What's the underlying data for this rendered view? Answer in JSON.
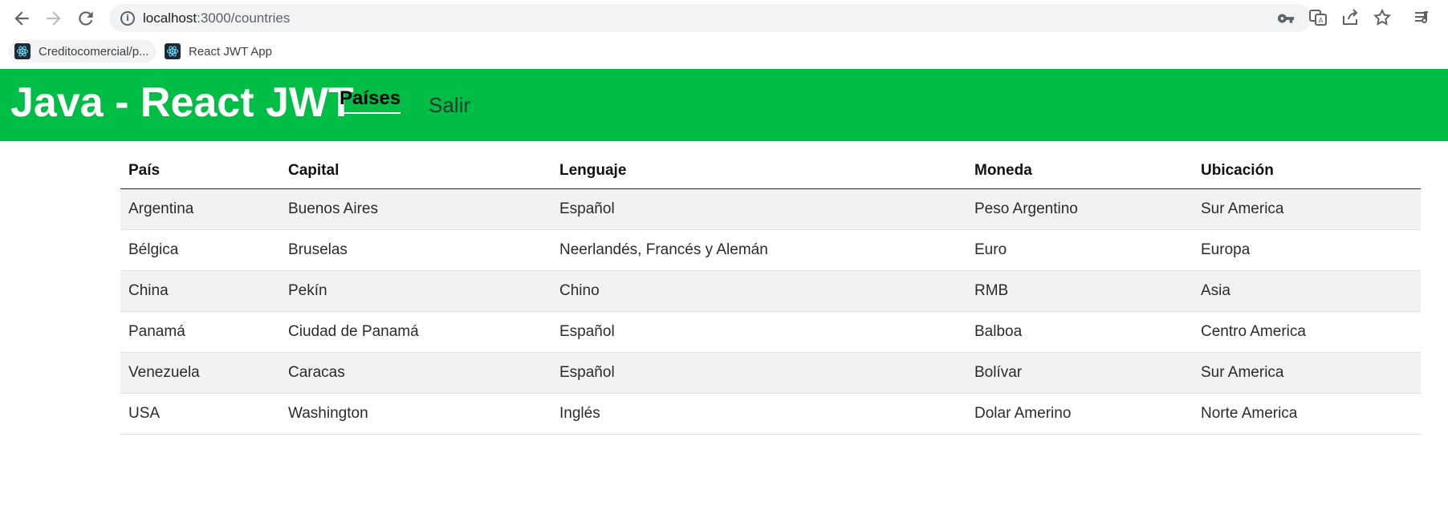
{
  "browser": {
    "url_host": "localhost",
    "url_path": ":3000/countries",
    "icons": [
      "back-arrow-icon",
      "forward-arrow-icon",
      "reload-icon",
      "info-icon",
      "key-icon",
      "translate-icon",
      "share-icon",
      "star-icon",
      "reading-list-icon"
    ]
  },
  "bookmarks": [
    {
      "label": "Creditocomercial/p..."
    },
    {
      "label": "React JWT App"
    }
  ],
  "app": {
    "brand": "Java - React JWT",
    "nav": {
      "countries": "Países",
      "logout": "Salir"
    },
    "accent_color": "#00bd45"
  },
  "table": {
    "headers": [
      "País",
      "Capital",
      "Lenguaje",
      "Moneda",
      "Ubicación"
    ],
    "rows": [
      [
        "Argentina",
        "Buenos Aires",
        "Español",
        "Peso Argentino",
        "Sur America"
      ],
      [
        "Bélgica",
        "Bruselas",
        "Neerlandés, Francés y Alemán",
        "Euro",
        "Europa"
      ],
      [
        "China",
        "Pekín",
        "Chino",
        "RMB",
        "Asia"
      ],
      [
        "Panamá",
        "Ciudad de Panamá",
        "Español",
        "Balboa",
        "Centro America"
      ],
      [
        "Venezuela",
        "Caracas",
        "Español",
        "Bolívar",
        "Sur America"
      ],
      [
        "USA",
        "Washington",
        "Inglés",
        "Dolar Amerino",
        "Norte America"
      ]
    ]
  }
}
